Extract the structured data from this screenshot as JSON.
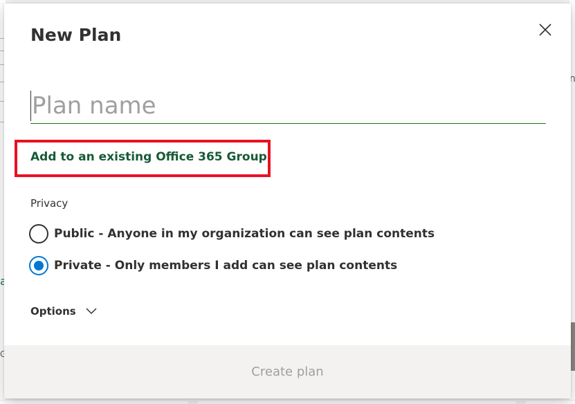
{
  "dialog": {
    "title": "New Plan",
    "close_icon": "close-icon",
    "plan_name": {
      "value": "",
      "placeholder": "Plan name"
    },
    "group_link_label": "Add to an existing Office 365 Group",
    "privacy": {
      "label": "Privacy",
      "options": [
        {
          "label": "Public - Anyone in my organization can see plan contents",
          "selected": false
        },
        {
          "label": "Private - Only members I add can see plan contents",
          "selected": true
        }
      ]
    },
    "options_label": "Options",
    "options_icon": "chevron-down-icon",
    "create_button_label": "Create plan"
  },
  "background": {
    "left_letter": "a",
    "left_letter_2": "G",
    "right_letter": "n"
  },
  "colors": {
    "accent_green": "#107c10",
    "link_green": "#185a36",
    "radio_blue": "#0078d4",
    "highlight_red": "#e81123",
    "disabled_text": "#a19f9d"
  }
}
